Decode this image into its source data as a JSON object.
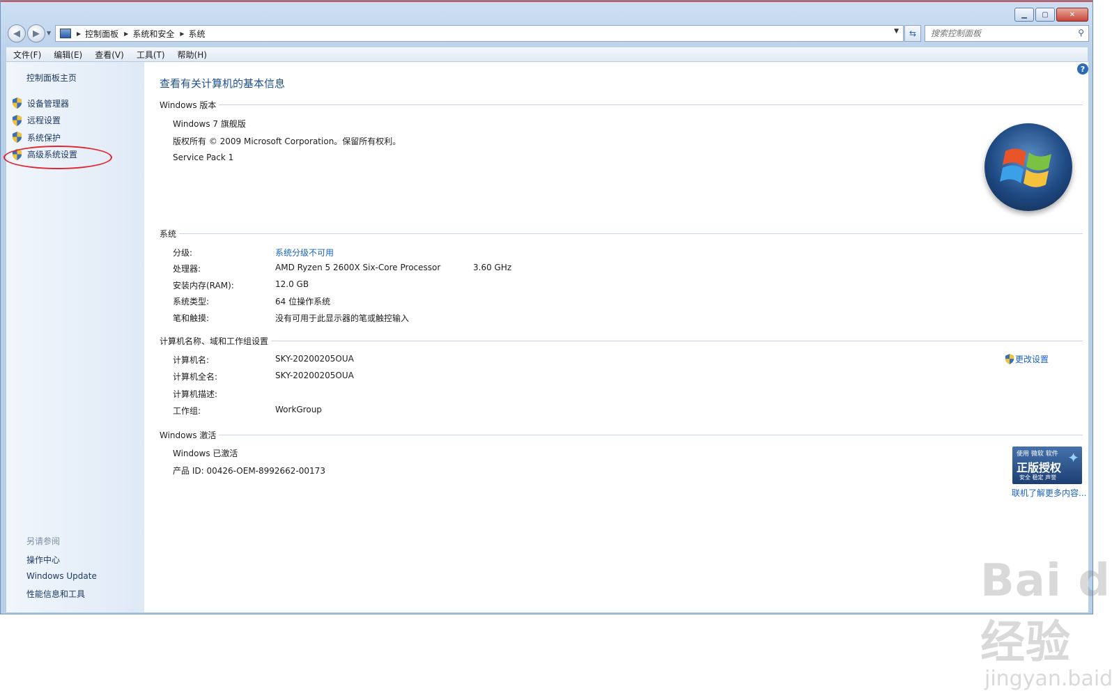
{
  "nav": {
    "back_icon": "back-arrow",
    "forward_icon": "forward-arrow",
    "breadcrumb": [
      "控制面板",
      "系统和安全",
      "系统"
    ],
    "search_placeholder": "搜索控制面板"
  },
  "menu": [
    "文件(F)",
    "编辑(E)",
    "查看(V)",
    "工具(T)",
    "帮助(H)"
  ],
  "sidebar": {
    "home": "控制面板主页",
    "tasks": [
      "设备管理器",
      "远程设置",
      "系统保护",
      "高级系统设置"
    ],
    "see_also_title": "另请参阅",
    "see_also": [
      "操作中心",
      "Windows Update",
      "性能信息和工具"
    ]
  },
  "main": {
    "title": "查看有关计算机的基本信息",
    "edition": {
      "header": "Windows 版本",
      "name": "Windows 7 旗舰版",
      "copyright": "版权所有 © 2009 Microsoft Corporation。保留所有权利。",
      "service_pack": "Service Pack 1"
    },
    "system": {
      "header": "系统",
      "rating_label": "分级:",
      "rating_value": "系统分级不可用",
      "processor_label": "处理器:",
      "processor_value": "AMD Ryzen 5 2600X Six-Core Processor",
      "processor_speed": "3.60 GHz",
      "ram_label": "安装内存(RAM):",
      "ram_value": "12.0 GB",
      "type_label": "系统类型:",
      "type_value": "64 位操作系统",
      "pen_label": "笔和触摸:",
      "pen_value": "没有可用于此显示器的笔或触控输入"
    },
    "computer": {
      "header": "计算机名称、域和工作组设置",
      "name_label": "计算机名:",
      "name_value": "SKY-20200205OUA",
      "fullname_label": "计算机全名:",
      "fullname_value": "SKY-20200205OUA",
      "desc_label": "计算机描述:",
      "workgroup_label": "工作组:",
      "workgroup_value": "WorkGroup",
      "change_link": "更改设置"
    },
    "activation": {
      "header": "Windows 激活",
      "status": "Windows 已激活",
      "product_id": "产品 ID: 00426-OEM-8992662-00173",
      "genuine_top": "使用 微软 软件",
      "genuine_main": "正版授权",
      "genuine_bottom": "安全 稳定 声誉",
      "learn_more": "联机了解更多内容..."
    }
  },
  "watermark": {
    "brand": "Bai du 经验",
    "url": "jingyan.baidu.com"
  }
}
